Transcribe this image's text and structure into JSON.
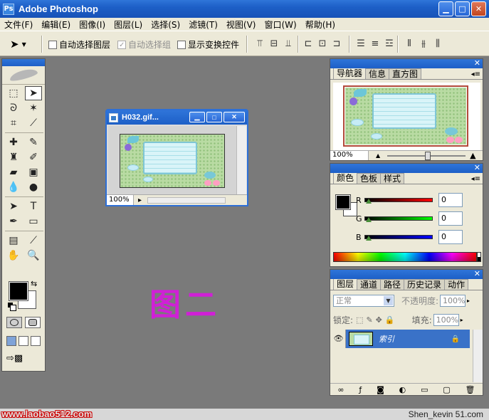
{
  "window": {
    "title": "Adobe Photoshop",
    "app_icon": "Ps",
    "controls": [
      "minimize",
      "maximize",
      "close"
    ]
  },
  "menu": [
    "文件(F)",
    "编辑(E)",
    "图像(I)",
    "图层(L)",
    "选择(S)",
    "滤镜(T)",
    "视图(V)",
    "窗口(W)",
    "帮助(H)"
  ],
  "options": {
    "auto_select_layer": "自动选择图层",
    "auto_select_group": "自动选择组",
    "show_transform": "显示变换控件"
  },
  "document": {
    "title": "H032.gif...",
    "zoom": "100%"
  },
  "navigator": {
    "tabs": [
      "导航器",
      "信息",
      "直方图"
    ],
    "zoom": "100%"
  },
  "color": {
    "tabs": [
      "颜色",
      "色板",
      "样式"
    ],
    "channels": [
      {
        "label": "R",
        "value": "0",
        "color": "#e02020"
      },
      {
        "label": "G",
        "value": "0",
        "color": "#18b018"
      },
      {
        "label": "B",
        "value": "0",
        "color": "#1a1ab8"
      }
    ]
  },
  "layers": {
    "tabs": [
      "图层",
      "通道",
      "路径",
      "历史记录",
      "动作"
    ],
    "blend_mode": "正常",
    "opacity_label": "不透明度:",
    "opacity": "100%",
    "lock_label": "锁定:",
    "fill_label": "填充:",
    "fill": "100%",
    "layer_name": "索引"
  },
  "overlay_label": "图二",
  "watermark_left": "www.laobao512.com",
  "watermark_right": "Shen_kevin 51.com"
}
